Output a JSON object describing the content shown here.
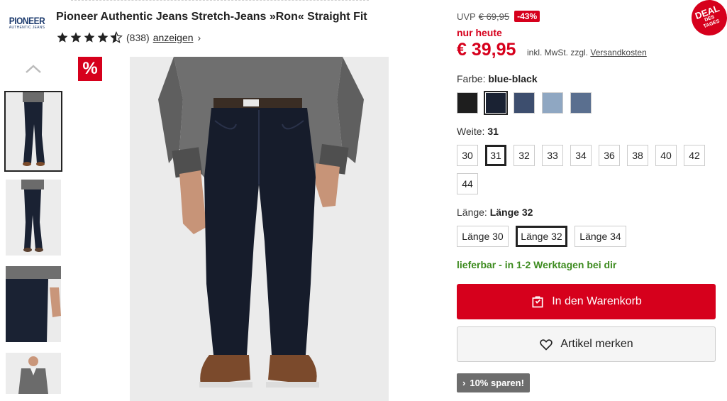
{
  "brand": {
    "logo_main": "PIONEER",
    "logo_sub": "AUTHENTIC JEANS"
  },
  "product": {
    "title": "Pioneer Authentic Jeans Stretch-Jeans »Ron« Straight Fit",
    "rating": {
      "stars": 4.5,
      "count": "(838)",
      "link_label": "anzeigen",
      "link_chevron": "›"
    }
  },
  "gallery": {
    "sale_badge": "%",
    "thumbnails": [
      {
        "alt": "front-full",
        "active": true
      },
      {
        "alt": "side-view",
        "active": false
      },
      {
        "alt": "detail-pocket",
        "active": false
      },
      {
        "alt": "outfit",
        "active": false
      }
    ]
  },
  "pricing": {
    "uvp_label": "UVP",
    "uvp_value": "€ 69,95",
    "discount": "-43%",
    "deal_line1": "DEAL",
    "deal_line2": "DES",
    "deal_line3": "TAGES",
    "nur_heute": "nur heute",
    "price": "€ 39,95",
    "price_note": "inkl. MwSt. zzgl.",
    "shipping_link": "Versandkosten"
  },
  "color": {
    "label": "Farbe:",
    "selected": "blue-black",
    "swatches": [
      {
        "name": "black",
        "hex": "#1e1e1e"
      },
      {
        "name": "blue-black",
        "hex": "#1a2233"
      },
      {
        "name": "dark-blue",
        "hex": "#3d4e6e"
      },
      {
        "name": "light-blue",
        "hex": "#8fa7c2"
      },
      {
        "name": "mid-blue",
        "hex": "#5a6f8f"
      }
    ]
  },
  "width": {
    "label": "Weite:",
    "selected": "31",
    "options": [
      "30",
      "31",
      "32",
      "33",
      "34",
      "36",
      "38",
      "40",
      "42",
      "44"
    ]
  },
  "length": {
    "label": "Länge:",
    "selected": "Länge 32",
    "options": [
      "Länge 30",
      "Länge 32",
      "Länge 34"
    ]
  },
  "delivery": "lieferbar - in 1-2 Werktagen bei dir",
  "actions": {
    "cart_label": "In den Warenkorb",
    "wishlist_label": "Artikel merken",
    "save_label": "10% sparen!",
    "save_chevron": "›"
  },
  "colors": {
    "accent": "#d6001c",
    "delivery": "#3d8b1f",
    "save_bg": "#6d6d6d"
  }
}
